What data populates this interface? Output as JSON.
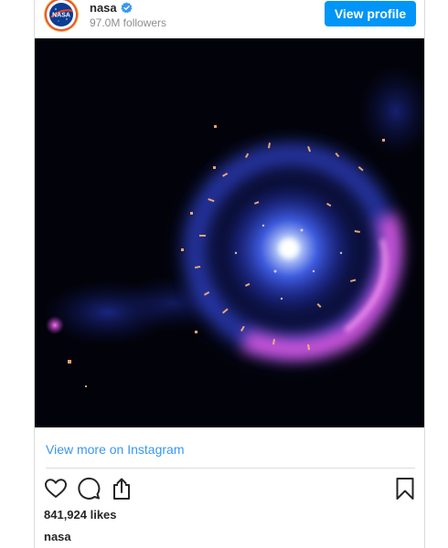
{
  "profile": {
    "username": "nasa",
    "followers": "97.0M followers",
    "view_profile_label": "View profile",
    "avatar_text": "NASA",
    "avatar_icon": "nasa-logo-icon",
    "verified_icon": "verified-badge-icon"
  },
  "media": {
    "image_description_icon": "nebula-image"
  },
  "links": {
    "view_more": "View more on Instagram"
  },
  "actions": {
    "like_icon": "heart-icon",
    "comment_icon": "comment-icon",
    "share_icon": "share-icon",
    "save_icon": "bookmark-icon"
  },
  "post": {
    "likes": "841,924 likes",
    "caption_username": "nasa"
  },
  "colors": {
    "accent": "#0095f6",
    "link": "#3897f0",
    "text": "#262626",
    "muted": "#8e8e8e",
    "border": "#dbdbdb"
  }
}
